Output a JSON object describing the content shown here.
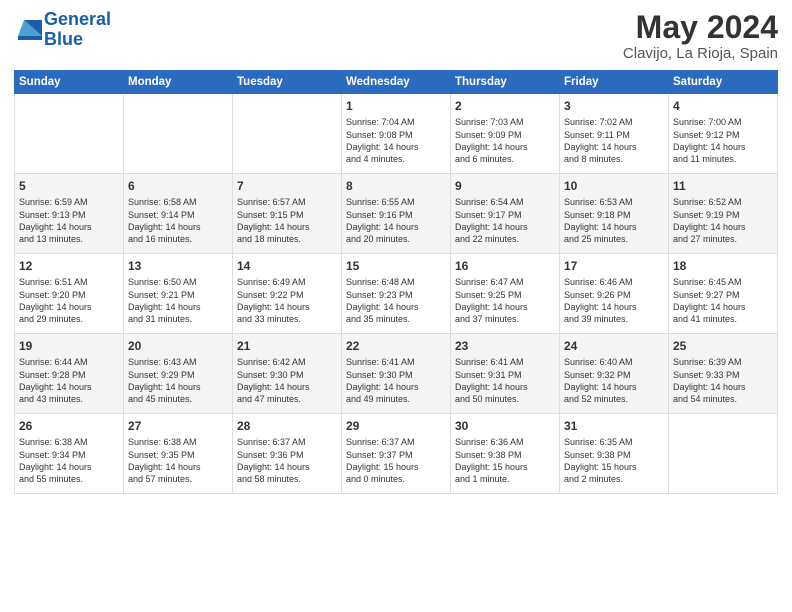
{
  "header": {
    "logo_line1": "General",
    "logo_line2": "Blue",
    "title": "May 2024",
    "subtitle": "Clavijo, La Rioja, Spain"
  },
  "columns": [
    "Sunday",
    "Monday",
    "Tuesday",
    "Wednesday",
    "Thursday",
    "Friday",
    "Saturday"
  ],
  "weeks": [
    [
      {
        "day": "",
        "info": ""
      },
      {
        "day": "",
        "info": ""
      },
      {
        "day": "",
        "info": ""
      },
      {
        "day": "1",
        "info": "Sunrise: 7:04 AM\nSunset: 9:08 PM\nDaylight: 14 hours\nand 4 minutes."
      },
      {
        "day": "2",
        "info": "Sunrise: 7:03 AM\nSunset: 9:09 PM\nDaylight: 14 hours\nand 6 minutes."
      },
      {
        "day": "3",
        "info": "Sunrise: 7:02 AM\nSunset: 9:11 PM\nDaylight: 14 hours\nand 8 minutes."
      },
      {
        "day": "4",
        "info": "Sunrise: 7:00 AM\nSunset: 9:12 PM\nDaylight: 14 hours\nand 11 minutes."
      }
    ],
    [
      {
        "day": "5",
        "info": "Sunrise: 6:59 AM\nSunset: 9:13 PM\nDaylight: 14 hours\nand 13 minutes."
      },
      {
        "day": "6",
        "info": "Sunrise: 6:58 AM\nSunset: 9:14 PM\nDaylight: 14 hours\nand 16 minutes."
      },
      {
        "day": "7",
        "info": "Sunrise: 6:57 AM\nSunset: 9:15 PM\nDaylight: 14 hours\nand 18 minutes."
      },
      {
        "day": "8",
        "info": "Sunrise: 6:55 AM\nSunset: 9:16 PM\nDaylight: 14 hours\nand 20 minutes."
      },
      {
        "day": "9",
        "info": "Sunrise: 6:54 AM\nSunset: 9:17 PM\nDaylight: 14 hours\nand 22 minutes."
      },
      {
        "day": "10",
        "info": "Sunrise: 6:53 AM\nSunset: 9:18 PM\nDaylight: 14 hours\nand 25 minutes."
      },
      {
        "day": "11",
        "info": "Sunrise: 6:52 AM\nSunset: 9:19 PM\nDaylight: 14 hours\nand 27 minutes."
      }
    ],
    [
      {
        "day": "12",
        "info": "Sunrise: 6:51 AM\nSunset: 9:20 PM\nDaylight: 14 hours\nand 29 minutes."
      },
      {
        "day": "13",
        "info": "Sunrise: 6:50 AM\nSunset: 9:21 PM\nDaylight: 14 hours\nand 31 minutes."
      },
      {
        "day": "14",
        "info": "Sunrise: 6:49 AM\nSunset: 9:22 PM\nDaylight: 14 hours\nand 33 minutes."
      },
      {
        "day": "15",
        "info": "Sunrise: 6:48 AM\nSunset: 9:23 PM\nDaylight: 14 hours\nand 35 minutes."
      },
      {
        "day": "16",
        "info": "Sunrise: 6:47 AM\nSunset: 9:25 PM\nDaylight: 14 hours\nand 37 minutes."
      },
      {
        "day": "17",
        "info": "Sunrise: 6:46 AM\nSunset: 9:26 PM\nDaylight: 14 hours\nand 39 minutes."
      },
      {
        "day": "18",
        "info": "Sunrise: 6:45 AM\nSunset: 9:27 PM\nDaylight: 14 hours\nand 41 minutes."
      }
    ],
    [
      {
        "day": "19",
        "info": "Sunrise: 6:44 AM\nSunset: 9:28 PM\nDaylight: 14 hours\nand 43 minutes."
      },
      {
        "day": "20",
        "info": "Sunrise: 6:43 AM\nSunset: 9:29 PM\nDaylight: 14 hours\nand 45 minutes."
      },
      {
        "day": "21",
        "info": "Sunrise: 6:42 AM\nSunset: 9:30 PM\nDaylight: 14 hours\nand 47 minutes."
      },
      {
        "day": "22",
        "info": "Sunrise: 6:41 AM\nSunset: 9:30 PM\nDaylight: 14 hours\nand 49 minutes."
      },
      {
        "day": "23",
        "info": "Sunrise: 6:41 AM\nSunset: 9:31 PM\nDaylight: 14 hours\nand 50 minutes."
      },
      {
        "day": "24",
        "info": "Sunrise: 6:40 AM\nSunset: 9:32 PM\nDaylight: 14 hours\nand 52 minutes."
      },
      {
        "day": "25",
        "info": "Sunrise: 6:39 AM\nSunset: 9:33 PM\nDaylight: 14 hours\nand 54 minutes."
      }
    ],
    [
      {
        "day": "26",
        "info": "Sunrise: 6:38 AM\nSunset: 9:34 PM\nDaylight: 14 hours\nand 55 minutes."
      },
      {
        "day": "27",
        "info": "Sunrise: 6:38 AM\nSunset: 9:35 PM\nDaylight: 14 hours\nand 57 minutes."
      },
      {
        "day": "28",
        "info": "Sunrise: 6:37 AM\nSunset: 9:36 PM\nDaylight: 14 hours\nand 58 minutes."
      },
      {
        "day": "29",
        "info": "Sunrise: 6:37 AM\nSunset: 9:37 PM\nDaylight: 15 hours\nand 0 minutes."
      },
      {
        "day": "30",
        "info": "Sunrise: 6:36 AM\nSunset: 9:38 PM\nDaylight: 15 hours\nand 1 minute."
      },
      {
        "day": "31",
        "info": "Sunrise: 6:35 AM\nSunset: 9:38 PM\nDaylight: 15 hours\nand 2 minutes."
      },
      {
        "day": "",
        "info": ""
      }
    ]
  ]
}
